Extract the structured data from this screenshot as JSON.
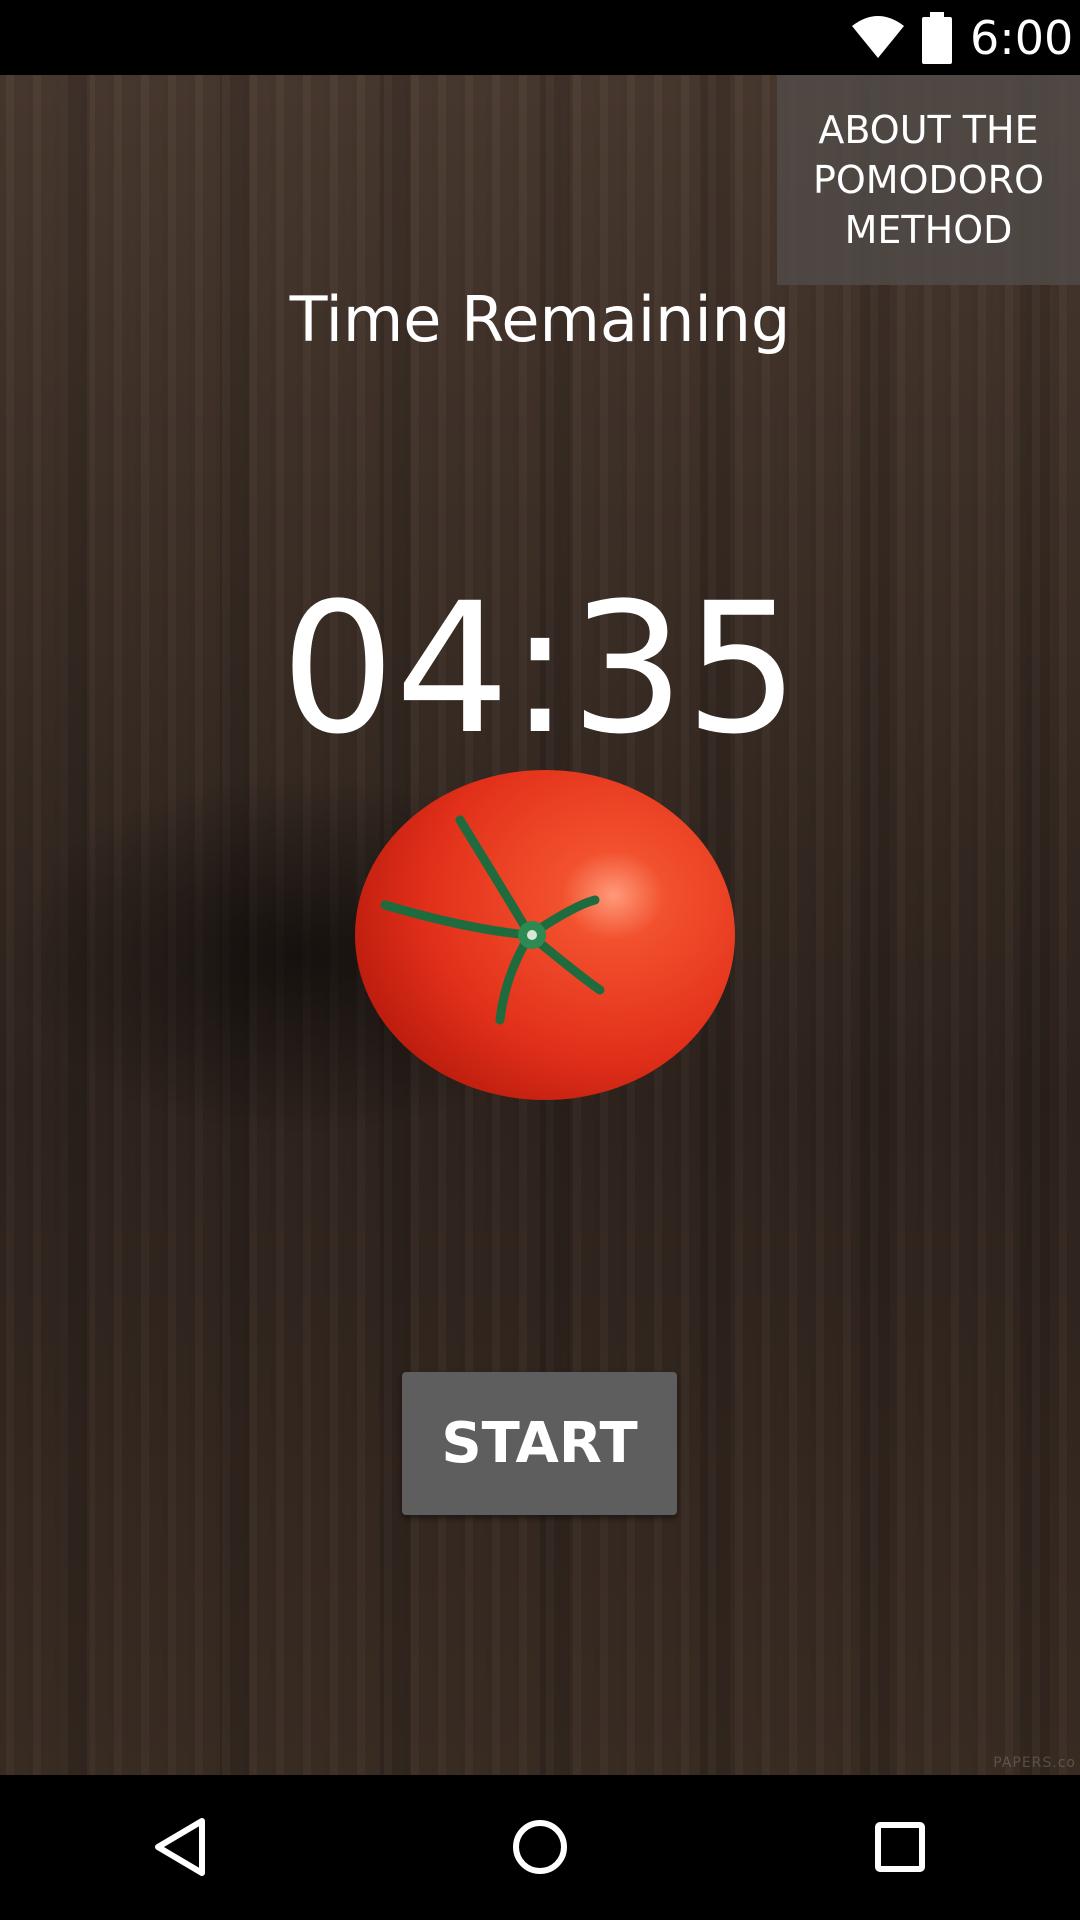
{
  "status_bar": {
    "time": "6:00",
    "wifi_icon": "wifi-icon",
    "battery_icon": "battery-icon"
  },
  "about_button": {
    "label": "ABOUT THE POMODORO METHOD"
  },
  "timer": {
    "label": "Time Remaining",
    "value": "04:35"
  },
  "tomato_image": {
    "icon": "tomato-image"
  },
  "start_button": {
    "label": "START"
  },
  "watermark": {
    "text": "PAPERS.co"
  },
  "nav_bar": {
    "back_icon": "back-icon",
    "home_icon": "home-icon",
    "recents_icon": "recents-icon"
  },
  "colors": {
    "status_bar_bg": "#000000",
    "button_bg": "#5e5e5e",
    "about_bg": "#504a46",
    "text": "#ffffff",
    "tomato": "#e8351c"
  }
}
